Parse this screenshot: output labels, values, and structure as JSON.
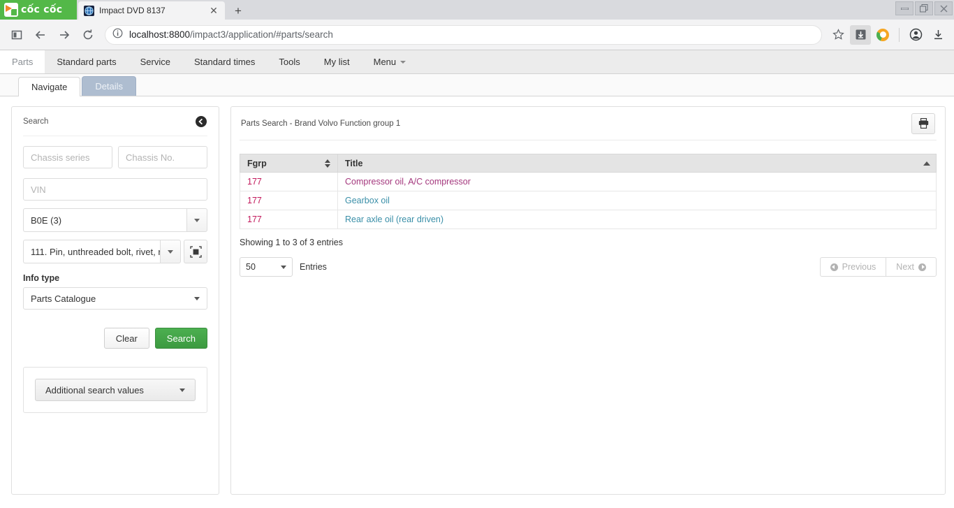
{
  "browser": {
    "brand": "cốc cốc",
    "tab": {
      "title": "Impact DVD 8137",
      "favicon": "globe-icon",
      "close": "✕"
    },
    "new_tab_label": "+",
    "window_controls": {
      "minimize": "—",
      "restore": "❐",
      "close": "✕"
    },
    "url_host": "localhost:8800",
    "url_path": "/impact3/application/#parts/search",
    "toolbar_icons": [
      "sidebar-toggle-icon",
      "back-icon",
      "forward-icon",
      "reload-icon"
    ],
    "right_icons": [
      "bookmark-star-icon",
      "save-page-icon",
      "coccoc-icon",
      "profile-icon",
      "download-icon"
    ]
  },
  "appnav": {
    "items": [
      {
        "label": "Parts",
        "active": true
      },
      {
        "label": "Standard parts",
        "active": false
      },
      {
        "label": "Service",
        "active": false
      },
      {
        "label": "Standard times",
        "active": false
      },
      {
        "label": "Tools",
        "active": false
      },
      {
        "label": "My list",
        "active": false
      },
      {
        "label": "Menu",
        "active": false,
        "caret": true
      }
    ]
  },
  "subtabs": [
    {
      "label": "Navigate",
      "active": true
    },
    {
      "label": "Details",
      "active": false
    }
  ],
  "search_panel": {
    "title": "Search",
    "collapse_icon": "arrow-circle-left-icon",
    "chassis_series_placeholder": "Chassis series",
    "chassis_series_value": "",
    "chassis_no_placeholder": "Chassis No.",
    "chassis_no_value": "",
    "vin_placeholder": "VIN",
    "vin_value": "",
    "model_value": "B0E (3)",
    "function_group_value": "111. Pin, unthreaded bolt, rivet, r",
    "expand_icon": "expand-selector-icon",
    "info_type_label": "Info type",
    "info_type_value": "Parts Catalogue",
    "clear_label": "Clear",
    "search_label": "Search",
    "additional_label": "Additional search values",
    "accent_green": "#4caf50"
  },
  "results": {
    "header_title": "Parts Search - Brand Volvo Function group 1",
    "print_icon": "printer-icon",
    "columns": [
      {
        "key": "fgrp",
        "label": "Fgrp",
        "sort": "both"
      },
      {
        "key": "title",
        "label": "Title",
        "sort": "asc"
      }
    ],
    "rows": [
      {
        "fgrp": "177",
        "title": "Compressor oil, A/C compressor",
        "visited": true
      },
      {
        "fgrp": "177",
        "title": "Gearbox oil",
        "visited": false
      },
      {
        "fgrp": "177",
        "title": "Rear axle oil (rear driven)",
        "visited": false
      }
    ],
    "showing_text": "Showing 1 to 3 of 3 entries",
    "entries_value": "50",
    "entries_label": "Entries",
    "previous_label": "Previous",
    "next_label": "Next",
    "link_visited_color": "#a4377d",
    "link_color": "#3a8fa8"
  }
}
